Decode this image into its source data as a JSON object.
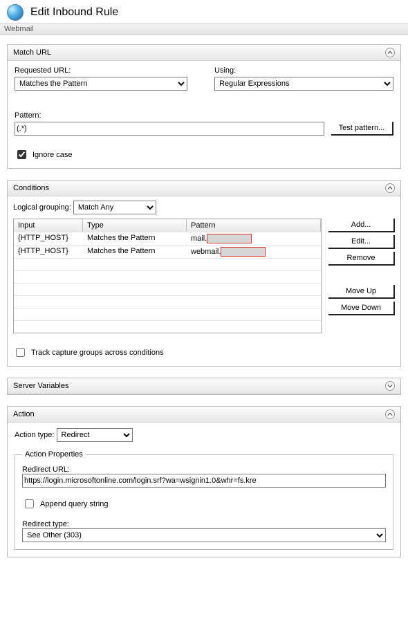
{
  "header": {
    "title": "Edit Inbound Rule"
  },
  "breadcrumb": "Webmail",
  "matchUrl": {
    "panelTitle": "Match URL",
    "requestedUrlLabel": "Requested URL:",
    "requestedUrlValue": "Matches the Pattern",
    "usingLabel": "Using:",
    "usingValue": "Regular Expressions",
    "patternLabel": "Pattern:",
    "patternValue": "(.*)",
    "testPatternBtn": "Test pattern...",
    "ignoreCaseLabel": "Ignore case",
    "ignoreCaseChecked": true
  },
  "conditions": {
    "panelTitle": "Conditions",
    "logicalGroupingLabel": "Logical grouping:",
    "logicalGroupingValue": "Match Any",
    "columns": {
      "input": "Input",
      "type": "Type",
      "pattern": "Pattern"
    },
    "rows": [
      {
        "input": "{HTTP_HOST}",
        "type": "Matches the Pattern",
        "patternPrefix": "mail.",
        "redacted": "████████"
      },
      {
        "input": "{HTTP_HOST}",
        "type": "Matches the Pattern",
        "patternPrefix": "webmail.",
        "redacted": "████████"
      }
    ],
    "buttons": {
      "add": "Add...",
      "edit": "Edit...",
      "remove": "Remove",
      "moveUp": "Move Up",
      "moveDown": "Move Down"
    },
    "trackCaptureLabel": "Track capture groups across conditions",
    "trackCaptureChecked": false
  },
  "serverVariables": {
    "panelTitle": "Server Variables"
  },
  "action": {
    "panelTitle": "Action",
    "actionTypeLabel": "Action type:",
    "actionTypeValue": "Redirect",
    "propertiesLegend": "Action Properties",
    "redirectUrlLabel": "Redirect URL:",
    "redirectUrlValue": "https://login.microsoftonline.com/login.srf?wa=wsignin1.0&whr=fs.kre",
    "appendQueryLabel": "Append query string",
    "appendQueryChecked": false,
    "redirectTypeLabel": "Redirect type:",
    "redirectTypeValue": "See Other (303)"
  }
}
